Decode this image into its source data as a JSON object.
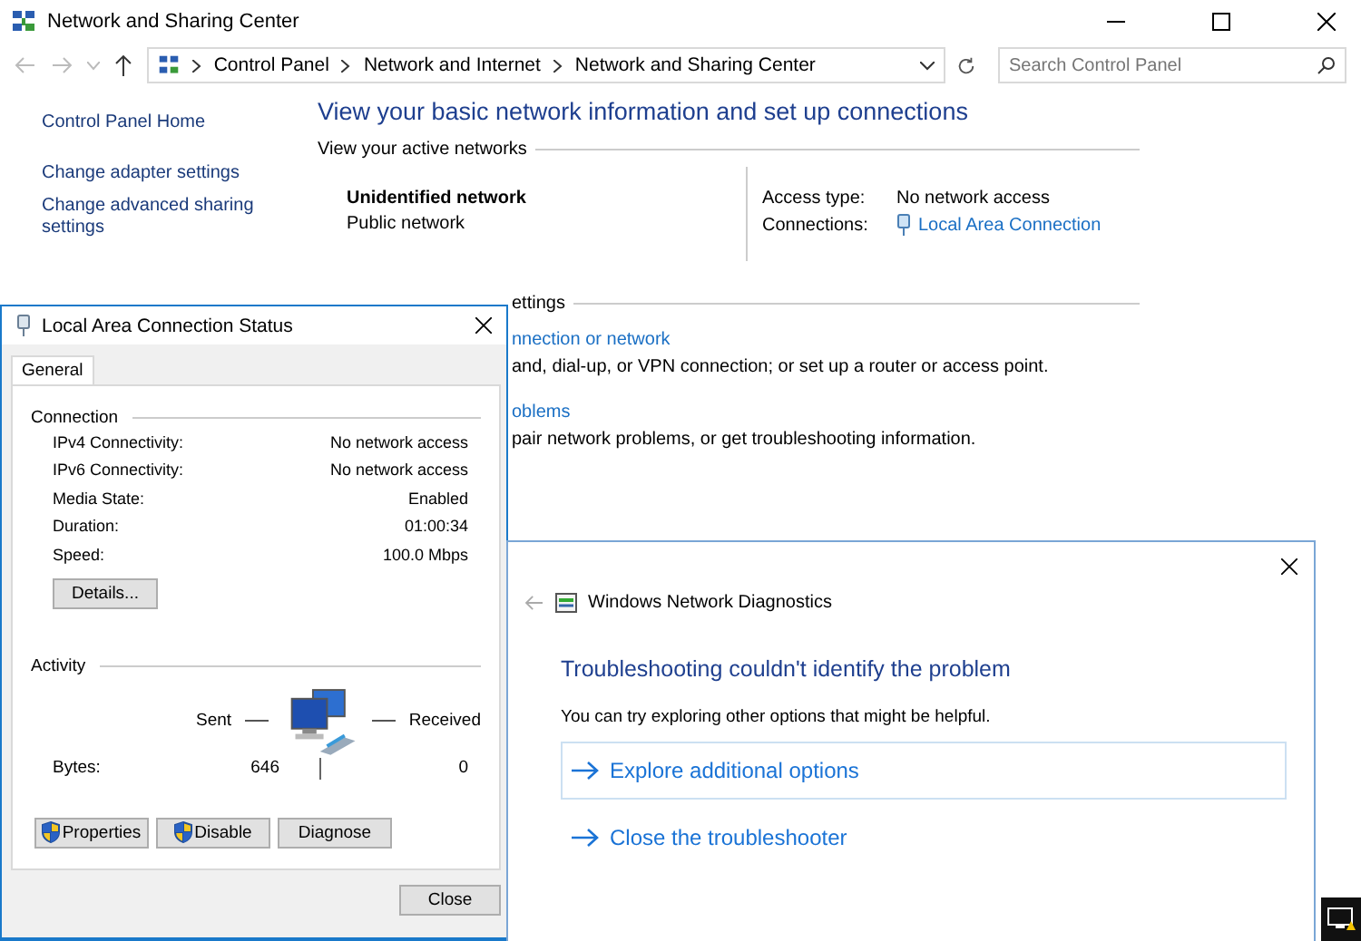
{
  "main_window": {
    "title": "Network and Sharing Center",
    "address_bar": {
      "breadcrumbs": [
        "Control Panel",
        "Network and Internet",
        "Network and Sharing Center"
      ]
    },
    "search": {
      "placeholder": "Search Control Panel"
    },
    "sidebar": {
      "items": [
        "Control Panel Home",
        "Change adapter settings",
        "Change advanced sharing settings"
      ]
    },
    "heading": "View your basic network information and set up connections",
    "active_networks": {
      "label": "View your active networks",
      "network_name": "Unidentified network",
      "network_type": "Public network",
      "details": [
        {
          "label": "Access type:",
          "value": "No network access",
          "kind": "text"
        },
        {
          "label": "Connections:",
          "value": "Local Area Connection",
          "kind": "link"
        }
      ]
    },
    "settings_section": {
      "label": "ettings",
      "items": [
        {
          "kind": "link",
          "text": "nnection or network"
        },
        {
          "kind": "text",
          "text": "and, dial-up, or VPN connection; or set up a router or access point."
        },
        {
          "kind": "link",
          "text": "oblems"
        },
        {
          "kind": "text",
          "text": "pair network problems, or get troubleshooting information."
        }
      ]
    }
  },
  "status_dialog": {
    "title": "Local Area Connection Status",
    "tabs": [
      {
        "label": "General",
        "selected": true
      }
    ],
    "connection": {
      "label": "Connection",
      "rows": [
        {
          "label": "IPv4 Connectivity:",
          "value": "No network access"
        },
        {
          "label": "IPv6 Connectivity:",
          "value": "No network access"
        },
        {
          "label": "Media State:",
          "value": "Enabled"
        },
        {
          "label": "Duration:",
          "value": "01:00:34"
        },
        {
          "label": "Speed:",
          "value": "100.0 Mbps"
        }
      ],
      "button": "Details..."
    },
    "activity": {
      "label": "Activity",
      "sent_label": "Sent",
      "received_label": "Received",
      "bytes_label": "Bytes:",
      "sent": "646",
      "received": "0"
    },
    "buttons": [
      {
        "label": "Properties",
        "shield": true
      },
      {
        "label": "Disable",
        "shield": true
      },
      {
        "label": "Diagnose",
        "shield": false
      }
    ],
    "close_button": "Close"
  },
  "diagnostics_dialog": {
    "title": "Windows Network Diagnostics",
    "heading": "Troubleshooting couldn't identify the problem",
    "message": "You can try exploring other options that might be helpful.",
    "options": [
      {
        "text": "Explore additional options",
        "selected": true
      },
      {
        "text": "Close the troubleshooter",
        "selected": false
      }
    ]
  }
}
